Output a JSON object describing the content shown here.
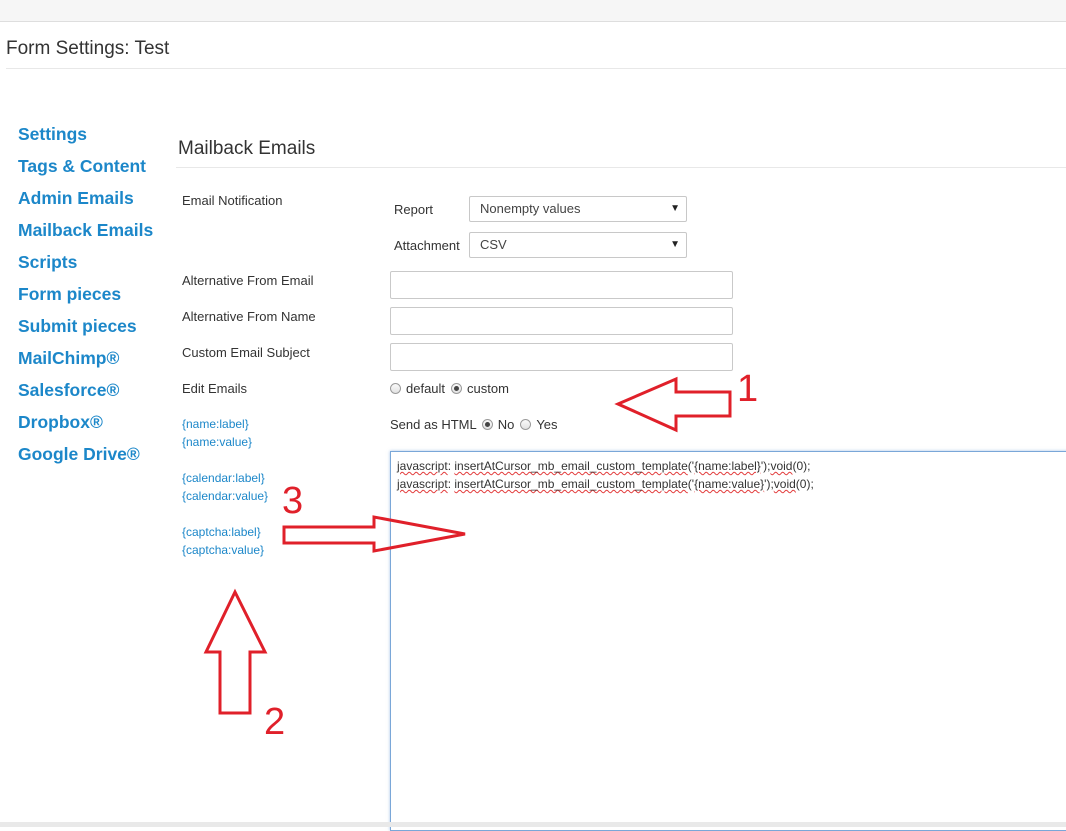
{
  "page": {
    "title": "Form Settings: Test"
  },
  "sidebar": {
    "items": [
      {
        "label": "Settings"
      },
      {
        "label": "Tags & Content"
      },
      {
        "label": "Admin Emails"
      },
      {
        "label": "Mailback Emails"
      },
      {
        "label": "Scripts"
      },
      {
        "label": "Form pieces"
      },
      {
        "label": "Submit pieces"
      },
      {
        "label": "MailChimp®"
      },
      {
        "label": "Salesforce®"
      },
      {
        "label": "Dropbox®"
      },
      {
        "label": "Google Drive®"
      }
    ]
  },
  "section": {
    "title": "Mailback Emails"
  },
  "notification": {
    "label": "Email Notification",
    "report_label": "Report",
    "report_value": "Nonempty values",
    "attachment_label": "Attachment",
    "attachment_value": "CSV"
  },
  "fields": {
    "alt_from_email_label": "Alternative From Email",
    "alt_from_email_value": "",
    "alt_from_name_label": "Alternative From Name",
    "alt_from_name_value": "",
    "subject_label": "Custom Email Subject",
    "subject_value": ""
  },
  "edit_emails": {
    "label": "Edit Emails",
    "default_label": "default",
    "custom_label": "custom",
    "selected": "custom"
  },
  "send_html": {
    "label": "Send as HTML",
    "no_label": "No",
    "yes_label": "Yes",
    "selected": "No"
  },
  "tags": [
    "{name:label}",
    "{name:value}",
    "{calendar:label}",
    "{calendar:value}",
    "{captcha:label}",
    "{captcha:value}"
  ],
  "editor": {
    "lines": [
      {
        "p1": "javascript",
        "p2": ": ",
        "p3": "insertAtCursor_mb_email_custom_template",
        "p4": "('",
        "p5": "{name:label}",
        "p6": "');",
        "p7": "void",
        "p8": "(0);"
      },
      {
        "p1": "javascript",
        "p2": ": ",
        "p3": "insertAtCursor_mb_email_custom_template",
        "p4": "('",
        "p5": "{name:value}",
        "p6": "');",
        "p7": "void",
        "p8": "(0);"
      }
    ]
  },
  "annotations": {
    "color": "#e0202a",
    "labels": [
      "1",
      "2",
      "3"
    ]
  }
}
